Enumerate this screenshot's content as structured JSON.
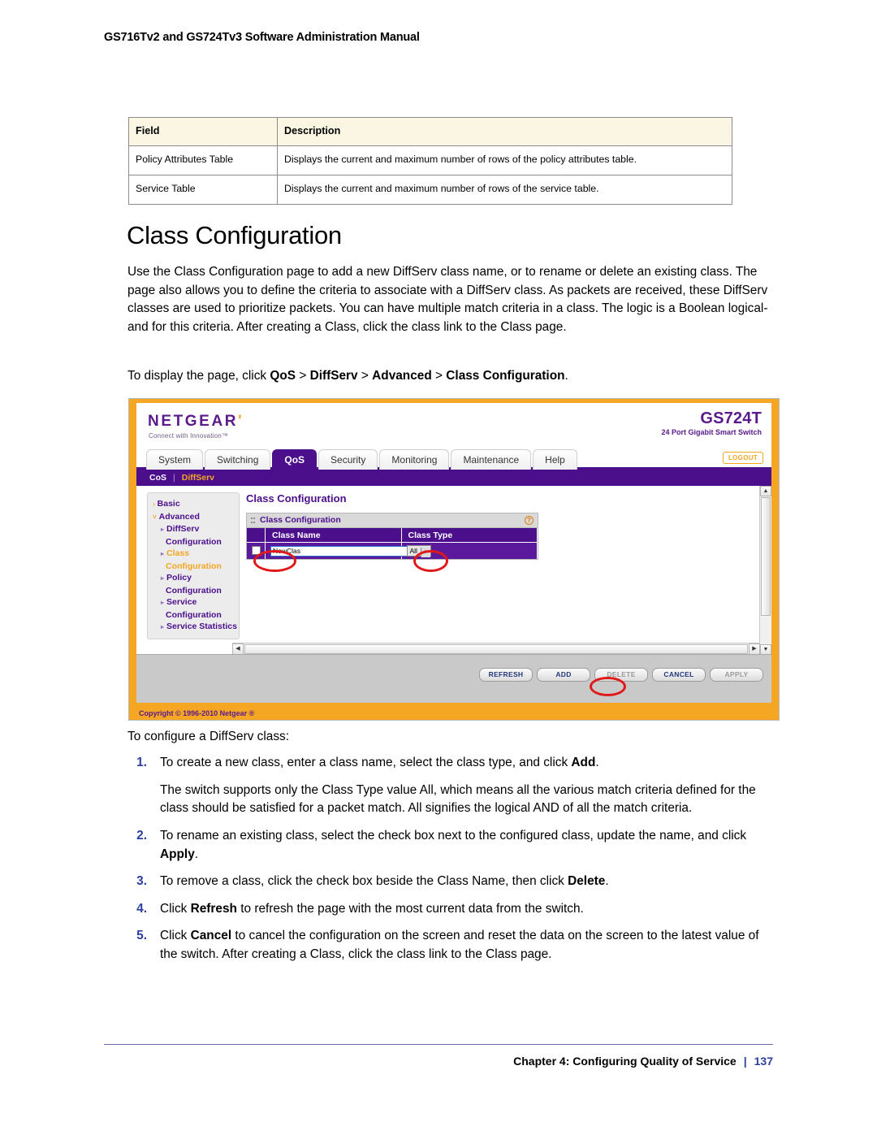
{
  "page": {
    "running_head": "GS716Tv2 and GS724Tv3 Software Administration Manual",
    "footer_chapter": "Chapter 4: Configuring Quality of Service",
    "footer_divider": "|",
    "page_number": "137"
  },
  "field_table": {
    "headers": [
      "Field",
      "Description"
    ],
    "rows": [
      {
        "field": "Policy Attributes Table",
        "description": "Displays the current and maximum number of rows of the policy attributes table."
      },
      {
        "field": "Service Table",
        "description": "Displays the current and maximum number of rows of the service table."
      }
    ]
  },
  "section": {
    "heading": "Class Configuration",
    "intro": "Use the Class Configuration page to add a new DiffServ class name, or to rename or delete an existing class. The page also allows you to define the criteria to associate with a DiffServ class. As packets are received, these DiffServ classes are used to prioritize packets. You can have multiple match criteria in a class. The logic is a Boolean logical-and for this criteria. After creating a Class, click the class link to the Class page.",
    "nav_prefix": "To display the page, click ",
    "nav_path": [
      "QoS",
      "DiffServ",
      "Advanced",
      "Class Configuration"
    ],
    "nav_separator": ">",
    "nav_suffix": "."
  },
  "screenshot": {
    "brand": {
      "logo": "NETGEAR",
      "logo_tick": "'",
      "tagline": "Connect with Innovation™",
      "model": "GS724T",
      "model_sub": "24 Port Gigabit Smart Switch"
    },
    "tabs": [
      {
        "label": "System",
        "active": false
      },
      {
        "label": "Switching",
        "active": false
      },
      {
        "label": "QoS",
        "active": true
      },
      {
        "label": "Security",
        "active": false
      },
      {
        "label": "Monitoring",
        "active": false
      },
      {
        "label": "Maintenance",
        "active": false
      },
      {
        "label": "Help",
        "active": false
      }
    ],
    "logout_label": "LOGOUT",
    "submenu": [
      {
        "label": "CoS",
        "selected": false
      },
      {
        "label": "DiffServ",
        "selected": true
      }
    ],
    "submenu_divider": "|",
    "nav": [
      {
        "label": "Basic",
        "level": 1,
        "marker": "›",
        "highlight": false
      },
      {
        "label": "Advanced",
        "level": 1,
        "marker": "˅",
        "highlight": false
      },
      {
        "label": "DiffServ",
        "level": 2,
        "marker": "▸",
        "highlight": false
      },
      {
        "label": "Configuration",
        "level": 3,
        "marker": "",
        "highlight": false
      },
      {
        "label": "Class",
        "level": 2,
        "marker": "▸",
        "highlight": true
      },
      {
        "label": "Configuration",
        "level": 3,
        "marker": "",
        "highlight": true
      },
      {
        "label": "Policy",
        "level": 2,
        "marker": "▸",
        "highlight": false
      },
      {
        "label": "Configuration",
        "level": 3,
        "marker": "",
        "highlight": false
      },
      {
        "label": "Service",
        "level": 2,
        "marker": "▸",
        "highlight": false
      },
      {
        "label": "Configuration",
        "level": 3,
        "marker": "",
        "highlight": false
      },
      {
        "label": "Service Statistics",
        "level": 2,
        "marker": "▸",
        "highlight": false
      }
    ],
    "main": {
      "title": "Class Configuration",
      "panel_title": "Class Configuration",
      "help_glyph": "?",
      "table_headers": [
        "Class Name",
        "Class Type"
      ],
      "row": {
        "class_name_value": "NewClas",
        "class_type_value": "All",
        "class_type_arrow": "▾"
      }
    },
    "buttons": [
      {
        "label": "REFRESH",
        "disabled": false
      },
      {
        "label": "ADD",
        "disabled": false
      },
      {
        "label": "DELETE",
        "disabled": true
      },
      {
        "label": "CANCEL",
        "disabled": false
      },
      {
        "label": "APPLY",
        "disabled": true
      }
    ],
    "scroll": {
      "up_glyph": "▲",
      "down_glyph": "▼",
      "left_glyph": "◀",
      "right_glyph": "▶"
    },
    "copyright": "Copyright © 1996-2010 Netgear ®",
    "colors": {
      "frame_orange": "#f5a623",
      "brand_purple": "#5b1a8b",
      "nav_purple": "#4b0f8c",
      "annotation_red": "#e11818"
    }
  },
  "instructions": {
    "lead_in": "To configure a DiffServ class:",
    "steps": [
      {
        "num": "1.",
        "pre": "To create a new class, enter a class name, select the class type, and click ",
        "bold": "Add",
        "post": ".",
        "sub": "The switch supports only the Class Type value All, which means all the various match criteria defined for the class should be satisfied for a packet match. All signifies the logical AND of all the match criteria."
      },
      {
        "num": "2.",
        "pre": "To rename an existing class, select the check box next to the configured class, update the name, and click ",
        "bold": "Apply",
        "post": ".",
        "sub": ""
      },
      {
        "num": "3.",
        "pre": "To remove a class, click the check box beside the Class Name, then click ",
        "bold": "Delete",
        "post": ".",
        "sub": ""
      },
      {
        "num": "4.",
        "pre": "Click ",
        "bold": "Refresh",
        "post": " to refresh the page with the most current data from the switch.",
        "sub": ""
      },
      {
        "num": "5.",
        "pre": "Click ",
        "bold": "Cancel",
        "post": " to cancel the configuration on the screen and reset the data on the screen to the latest value of the switch. After creating a Class, click the class link to the Class page.",
        "sub": ""
      }
    ]
  }
}
